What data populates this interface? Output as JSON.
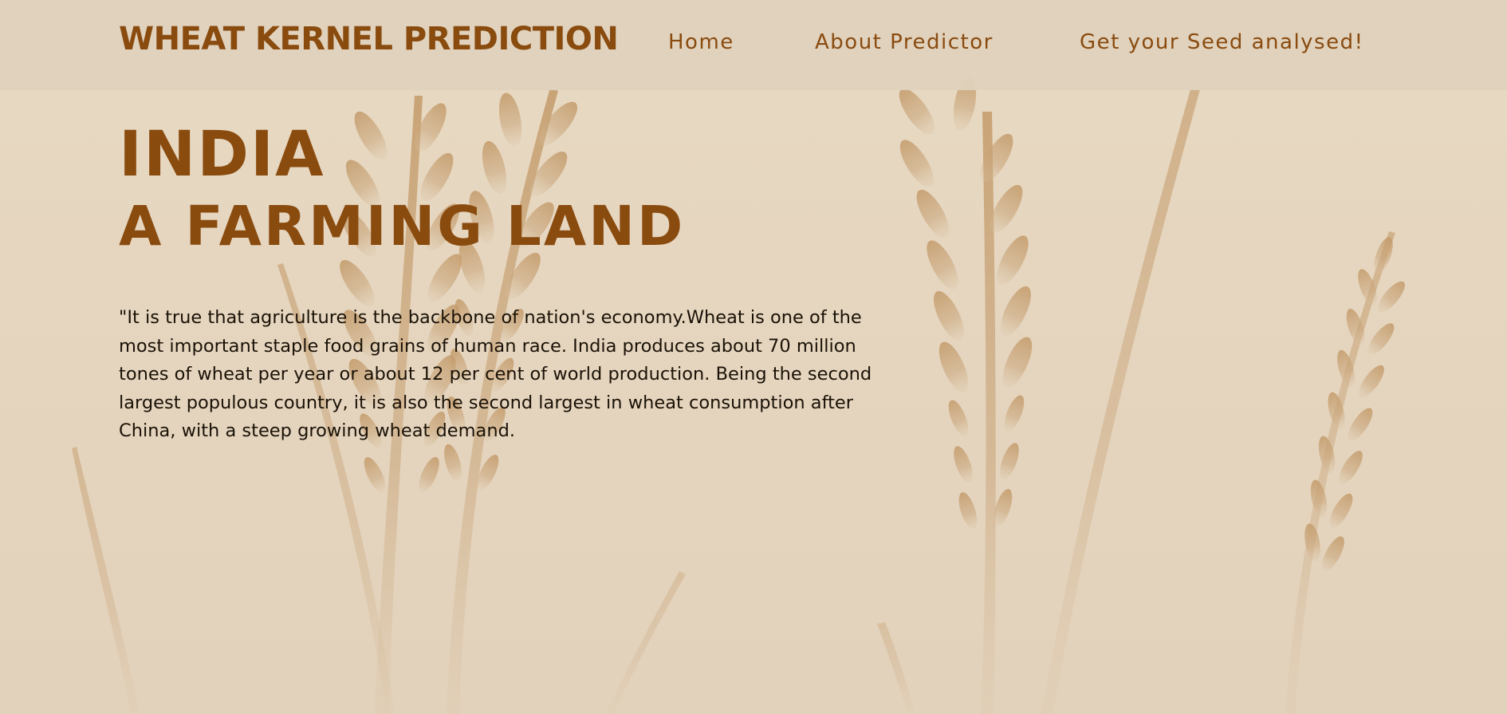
{
  "navbar": {
    "brand": "WHEAT KERNEL PREDICTION",
    "links": [
      {
        "label": "Home"
      },
      {
        "label": "About Predictor"
      },
      {
        "label": "Get your Seed analysed!"
      }
    ]
  },
  "hero": {
    "title": "INDIA",
    "subtitle": "A FARMING LAND",
    "quote": "\"It is true that agriculture is the backbone of nation's economy.Wheat is one of the most important staple food grains of human race. India produces about 70 million tones of wheat per year or about 12 per cent of world production. Being the second largest populous country, it is also the second largest in wheat consumption after China, with a steep growing wheat demand."
  },
  "colors": {
    "accent": "#8a4b0f",
    "background": "#e6d7c1",
    "navbar": "#e0d1bc",
    "body_text": "#1a1207",
    "wheat_illustration": "#c59e6e"
  },
  "icons": {
    "background_illustration": "wheat-stalks-illustration"
  }
}
